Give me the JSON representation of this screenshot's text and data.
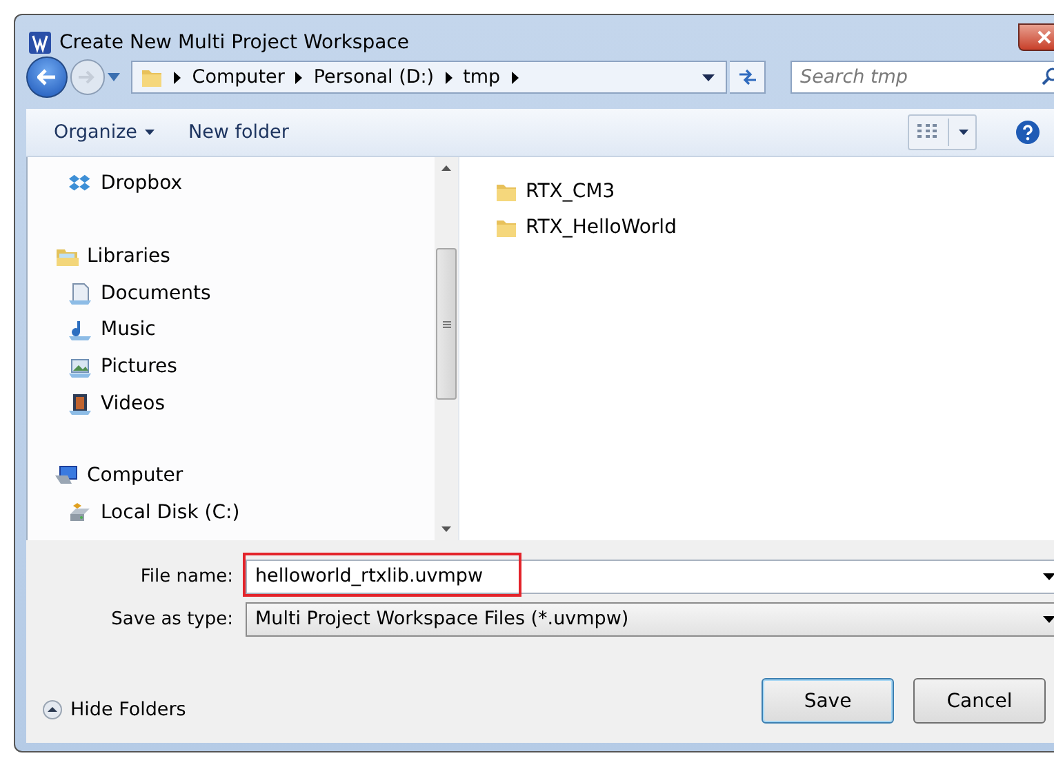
{
  "window": {
    "title": "Create New Multi Project Workspace"
  },
  "address_bar": {
    "segments": [
      "Computer",
      "Personal (D:)",
      "tmp"
    ]
  },
  "search": {
    "placeholder": "Search tmp"
  },
  "toolbar": {
    "organize": "Organize",
    "new_folder": "New folder"
  },
  "sidebar": {
    "items": [
      {
        "label": "Dropbox",
        "kind": "dropbox"
      },
      {
        "label": "Libraries",
        "kind": "libraries",
        "children": [
          {
            "label": "Documents",
            "kind": "documents"
          },
          {
            "label": "Music",
            "kind": "music"
          },
          {
            "label": "Pictures",
            "kind": "pictures"
          },
          {
            "label": "Videos",
            "kind": "videos"
          }
        ]
      },
      {
        "label": "Computer",
        "kind": "computer",
        "children": [
          {
            "label": "Local Disk (C:)",
            "kind": "disk"
          }
        ]
      }
    ]
  },
  "files": [
    {
      "name": "RTX_CM3"
    },
    {
      "name": "RTX_HelloWorld"
    }
  ],
  "file_name": {
    "label": "File name:",
    "value": "helloworld_rtxlib.uvmpw",
    "highlighted": true
  },
  "save_type": {
    "label": "Save as type:",
    "value": "Multi Project Workspace Files (*.uvmpw)"
  },
  "hide_folders": "Hide Folders",
  "buttons": [
    {
      "label": "Save",
      "default": true
    },
    {
      "label": "Cancel",
      "default": false
    }
  ]
}
